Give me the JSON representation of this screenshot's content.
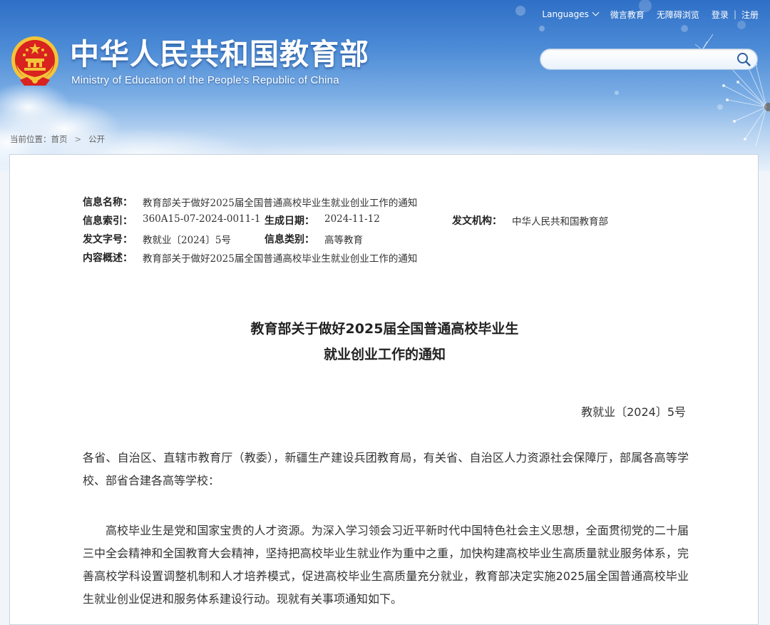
{
  "header": {
    "title_cn": "中华人民共和国教育部",
    "title_en": "Ministry of Education of the People's Republic of China",
    "emblem_icon": "national-emblem-icon"
  },
  "topnav": {
    "languages": "Languages",
    "weiyan": "微言教育",
    "accessibility": "无障碍浏览",
    "login": "登录",
    "separator": "|",
    "register": "注册"
  },
  "search": {
    "value": "",
    "placeholder": "",
    "icon": "search-icon"
  },
  "breadcrumb": {
    "prefix": "当前位置：",
    "home": "首页",
    "arrow": ">",
    "current": "公开"
  },
  "meta": {
    "name_label": "信息名称：",
    "name_value": "教育部关于做好2025届全国普通高校毕业生就业创业工作的通知",
    "index_label": "信息索引：",
    "index_value": "360A15-07-2024-0011-1",
    "date_label": "生成日期：",
    "date_value": "2024-11-12",
    "org_label": "发文机构：",
    "org_value": "中华人民共和国教育部",
    "docno_label": "发文字号：",
    "docno_value": "教就业〔2024〕5号",
    "category_label": "信息类别：",
    "category_value": "高等教育",
    "summary_label": "内容概述：",
    "summary_value": "教育部关于做好2025届全国普通高校毕业生就业创业工作的通知"
  },
  "document": {
    "title_line1": "教育部关于做好2025届全国普通高校毕业生",
    "title_line2": "就业创业工作的通知",
    "number": "教就业〔2024〕5号",
    "addressees": "各省、自治区、直辖市教育厅（教委），新疆生产建设兵团教育局，有关省、自治区人力资源社会保障厅，部属各高等学校、部省合建各高等学校：",
    "paragraph1": "高校毕业生是党和国家宝贵的人才资源。为深入学习领会习近平新时代中国特色社会主义思想，全面贯彻党的二十届三中全会精神和全国教育大会精神，坚持把高校毕业生就业作为重中之重，加快构建高校毕业生高质量就业服务体系，完善高校学科设置调整机制和人才培养模式，促进高校毕业生高质量充分就业，教育部决定实施2025届全国普通高校毕业生就业创业促进和服务体系建设行动。现就有关事项通知如下。"
  },
  "colors": {
    "banner_top": "#2f6fc6",
    "banner_bottom": "#e8f1fb",
    "emblem_red": "#d8231f",
    "emblem_gold": "#f3c53a"
  }
}
